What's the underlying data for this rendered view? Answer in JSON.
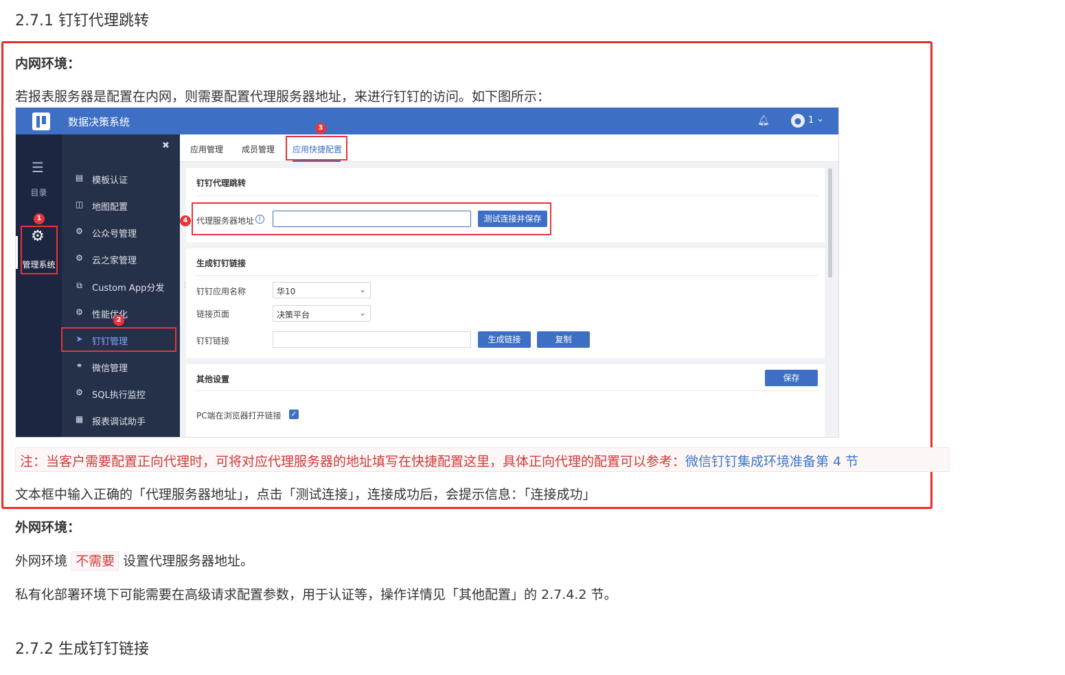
{
  "headings": {
    "h271": "2.7.1 钉钉代理跳转",
    "h272": "2.7.2 生成钉钉链接"
  },
  "intranet": {
    "label": "内网环境：",
    "desc": "若报表服务器是配置在内网，则需要配置代理服务器地址，来进行钉钉的访问。如下图所示：",
    "note_text": "注：当客户需要配置正向代理时，可将对应代理服务器的地址填写在快捷配置这里，具体正向代理的配置可以参考：",
    "note_link": "微信钉钉集成环境准备第 4 节",
    "instruction": "文本框中输入正确的「代理服务器地址」，点击「测试连接」，连接成功后，会提示信息：「连接成功」"
  },
  "extranet": {
    "label": "外网环境：",
    "desc_prefix": "外网环境",
    "desc_highlight": "不需要",
    "desc_suffix": "设置代理服务器地址。",
    "private": "私有化部署环境下可能需要在高级请求配置参数，用于认证等，操作详情见「其他配置」的 2.7.4.2 节。"
  },
  "screenshot": {
    "system_title": "数据决策系统",
    "user": "1",
    "rail": {
      "catalog": "目录",
      "admin": "管理系统"
    },
    "side_items": [
      {
        "label": "模板认证",
        "icon": "template-cert-icon",
        "glyph": "▤"
      },
      {
        "label": "地图配置",
        "icon": "map-icon",
        "glyph": "◫"
      },
      {
        "label": "公众号管理",
        "icon": "gear-icon",
        "glyph": "⚙"
      },
      {
        "label": "云之家管理",
        "icon": "gear-icon",
        "glyph": "⚙"
      },
      {
        "label": "Custom App分发",
        "icon": "custom-app-icon",
        "glyph": "⧉"
      },
      {
        "label": "性能优化",
        "icon": "gear-icon",
        "glyph": "⚙"
      },
      {
        "label": "钉钉管理",
        "icon": "dingtalk-icon",
        "glyph": "➤"
      },
      {
        "label": "微信管理",
        "icon": "wechat-icon",
        "glyph": "⚭"
      },
      {
        "label": "SQL执行监控",
        "icon": "gear-icon",
        "glyph": "⚙"
      },
      {
        "label": "报表调试助手",
        "icon": "debug-icon",
        "glyph": "▦"
      }
    ],
    "tabs": [
      "应用管理",
      "成员管理",
      "应用快捷配置"
    ],
    "proxy_section": {
      "title": "钉钉代理跳转",
      "field_label": "代理服务器地址",
      "button": "测试连接并保存"
    },
    "link_section": {
      "title": "生成钉钉链接",
      "app_label": "钉钉应用名称",
      "app_value": "华10",
      "page_label": "链接页面",
      "page_value": "决策平台",
      "link_label": "钉钉链接",
      "gen_button": "生成链接",
      "copy_button": "复制"
    },
    "other_section": {
      "title": "其他设置",
      "save_button": "保存",
      "checkbox_label": "PC端在浏览器打开链接",
      "checkbox_checked": true
    },
    "markers": [
      "1",
      "2",
      "3",
      "4"
    ],
    "colors": {
      "brand": "#3d6fc4",
      "marker": "#e8343a"
    }
  }
}
